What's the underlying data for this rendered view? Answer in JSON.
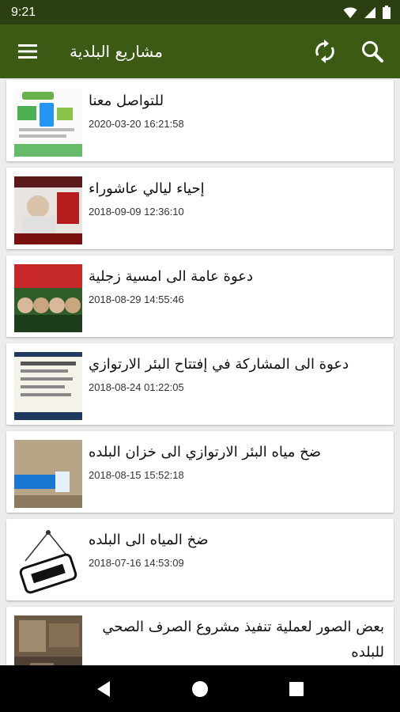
{
  "status": {
    "time": "9:21"
  },
  "app_bar": {
    "title": "مشاريع البلدية",
    "menu_icon": "menu-icon",
    "refresh_icon": "refresh-icon",
    "search_icon": "search-icon"
  },
  "colors": {
    "status_bar": "#2b3f10",
    "app_bar": "#3b5a14",
    "background": "#ececec"
  },
  "posts": [
    {
      "title": "للتواصل معنا",
      "date": "2020-03-20 16:21:58"
    },
    {
      "title": "إحياء ليالي عاشوراء",
      "date": "2018-09-09 12:36:10"
    },
    {
      "title": "دعوة عامة الى امسية زجلية",
      "date": "2018-08-29 14:55:46"
    },
    {
      "title": "دعوة الى المشاركة في إفتتاح البئر الارتوازي",
      "date": "2018-08-24 01:22:05"
    },
    {
      "title": "ضخ مياه البئر الارتوازي الى خزان البلده",
      "date": "2018-08-15 15:52:18"
    },
    {
      "title": "ضخ المياه الى البلده",
      "date": "2018-07-16 14:53:09"
    },
    {
      "title": "بعض الصور لعملية تنفيذ مشروع الصرف الصحي للبلده",
      "date": ""
    }
  ]
}
